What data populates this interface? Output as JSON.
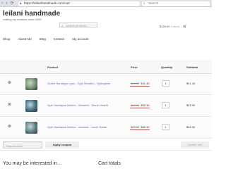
{
  "browser": {
    "url": "https://leilanihandmade.com/cart",
    "search_placeholder": "Search",
    "nav_icons": "‹ › ⟳"
  },
  "site": {
    "title": "leilani handmade",
    "tagline": "crafting my creations since 2005",
    "search_placeholder": "Search products…",
    "cart_total": "$128.00",
    "cart_items": "3 items"
  },
  "nav": [
    "Shop",
    "About Me",
    "Blog",
    "Contact",
    "My account"
  ],
  "table": {
    "headers": {
      "product": "Product",
      "price": "Price",
      "quantity": "Quantity",
      "subtotal": "Subtotal"
    },
    "rows": [
      {
        "name": "Green Handspun yarn - Spiz Worsted - Springtime",
        "old_price": "$46.00",
        "new_price": "$41.40",
        "qty": "1",
        "subtotal": "$41.40",
        "thumb_color": "#6f8f6a"
      },
      {
        "name": "Spiz Handspun Merino - Worsted - Stone Hearth",
        "old_price": "$47.00",
        "new_price": "$42.30",
        "qty": "1",
        "subtotal": "$42.30",
        "thumb_color": "#3f6f8a"
      },
      {
        "name": "Spiz Handspun Merino - worsted - Lunch Safari",
        "old_price": "$47.00",
        "new_price": "$42.30",
        "qty": "1",
        "subtotal": "$42.30",
        "thumb_color": "#5a7d86"
      }
    ]
  },
  "coupon": {
    "placeholder": "Coupon code",
    "apply_label": "Apply coupon",
    "update_label": "Update cart"
  },
  "sections": {
    "interested": "You may be interested in…",
    "cart_totals": "Cart totals"
  },
  "colors": {
    "link": "#7f54b3",
    "highlight": "#e8432b"
  },
  "icons": {
    "remove": "remove-icon",
    "cart": "cart-icon",
    "search": "search-icon",
    "lock": "lock-icon"
  }
}
